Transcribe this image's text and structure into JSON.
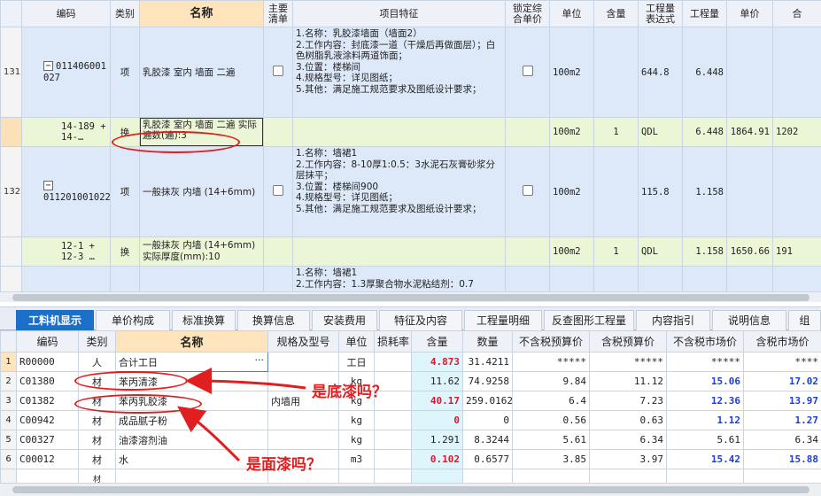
{
  "upper": {
    "headers": [
      "编码",
      "类别",
      "名称",
      "主要清单",
      "项目特征",
      "锁定综合单价",
      "单位",
      "含量",
      "工程量表达式",
      "工程量",
      "单价",
      "合"
    ],
    "rows": [
      {
        "idx": "131",
        "code": "011406001027",
        "type": "项",
        "name": "乳胶漆 室内 墙面 二遍",
        "features": [
          "1.名称：乳胶漆墙面（墙面2）",
          "2.工作内容：封底漆一道（干燥后再做面层）；白色树脂乳液涂料两道饰面；",
          "3.位置：楼梯间",
          "4.规格型号：详见图纸；",
          "5.其他：满足施工规范要求及图纸设计要求；"
        ],
        "unit": "100m2",
        "qty": "",
        "expr": "644.8",
        "amount": "6.448",
        "price": ""
      },
      {
        "idx": "",
        "code": "14-189 + 14-…",
        "type": "换",
        "name": "乳胶漆 室内 墙面 二遍 实际遍数(遍):3",
        "unit": "100m2",
        "qty": "1",
        "expr": "QDL",
        "amount": "6.448",
        "price": "1864.91",
        "extra": "1202"
      },
      {
        "idx": "132",
        "code": "011201001022",
        "type": "项",
        "name": "一般抹灰 内墙 (14+6mm)",
        "features": [
          "1.名称：墙裙1",
          "2.工作内容：8-10厚1:0.5：3水泥石灰膏砂浆分层抹平；",
          "3.位置：楼梯间900",
          "4.规格型号：详见图纸；",
          "5.其他：满足施工规范要求及图纸设计要求；"
        ],
        "unit": "100m2",
        "qty": "",
        "expr": "115.8",
        "amount": "1.158",
        "price": ""
      },
      {
        "idx": "",
        "code": "12-1 + 12-3 …",
        "type": "换",
        "name": "一般抹灰 内墙 (14+6mm) 实际厚度(mm):10",
        "unit": "100m2",
        "qty": "1",
        "expr": "QDL",
        "amount": "1.158",
        "price": "1650.66",
        "extra": "191"
      },
      {
        "idx": "",
        "code": "",
        "type": "",
        "name": "",
        "features": [
          "1.名称：墙裙1",
          "2.工作内容：1.3厚聚合物水泥粘结剂：0.7"
        ],
        "unit": "",
        "qty": "",
        "expr": "",
        "amount": "",
        "price": ""
      }
    ]
  },
  "tabs": [
    "工料机显示",
    "单价构成",
    "标准换算",
    "换算信息",
    "安装费用",
    "特征及内容",
    "工程量明细",
    "反查图形工程量",
    "内容指引",
    "说明信息",
    "组"
  ],
  "lower": {
    "headers": [
      "编码",
      "类别",
      "名称",
      "规格及型号",
      "单位",
      "损耗率",
      "含量",
      "数量",
      "不含税预算价",
      "含税预算价",
      "不含税市场价",
      "含税市场价"
    ],
    "rows": [
      {
        "n": "1",
        "code": "R00000",
        "type": "人",
        "name": "合计工日",
        "spec": "",
        "unit": "工日",
        "loss": "",
        "content": "4.873",
        "qty": "31.4211",
        "p1": "*****",
        "p2": "*****",
        "p3": "*****",
        "p4": "****"
      },
      {
        "n": "2",
        "code": "C01380",
        "type": "材",
        "name": "苯丙清漆",
        "spec": "",
        "unit": "kg",
        "loss": "",
        "content": "",
        "qty": "11.62",
        "p1": "74.9258",
        "p2": "9.84",
        "p3": "11.12",
        "p4": "15.06",
        "p5": "17.02"
      },
      {
        "n": "3",
        "code": "C01382",
        "type": "材",
        "name": "苯丙乳胶漆",
        "spec": "内墙用",
        "unit": "kg",
        "loss": "",
        "content": "40.17",
        "qty": "259.0162",
        "p1": "6.4",
        "p2": "7.23",
        "p3": "12.36",
        "p4": "13.97"
      },
      {
        "n": "4",
        "code": "C00942",
        "type": "材",
        "name": "成品腻子粉",
        "spec": "",
        "unit": "kg",
        "loss": "",
        "content": "0",
        "qty": "0",
        "p1": "0.56",
        "p2": "0.63",
        "p3": "1.12",
        "p4": "1.27"
      },
      {
        "n": "5",
        "code": "C00327",
        "type": "材",
        "name": "油漆溶剂油",
        "spec": "",
        "unit": "kg",
        "loss": "",
        "content": "1.291",
        "qty": "8.3244",
        "p1": "5.61",
        "p2": "6.34",
        "p3": "5.61",
        "p4": "6.34"
      },
      {
        "n": "6",
        "code": "C00012",
        "type": "材",
        "name": "水",
        "spec": "",
        "unit": "m3",
        "loss": "",
        "content": "0.102",
        "qty": "0.6577",
        "p1": "3.85",
        "p2": "3.97",
        "p3": "15.42",
        "p4": "15.88"
      },
      {
        "n": "7",
        "code": "",
        "type": "材",
        "name": "",
        "spec": "",
        "unit": "",
        "loss": "",
        "content": "",
        "qty": "",
        "p1": "",
        "p2": "",
        "p3": "",
        "p4": ""
      }
    ]
  },
  "annotations": {
    "q1": "是底漆吗？",
    "q2": "是面漆吗？"
  },
  "colors": {
    "tab_active": "#1b6fc8",
    "annotation": "#e02020",
    "highlight_header": "#fde4bd"
  }
}
